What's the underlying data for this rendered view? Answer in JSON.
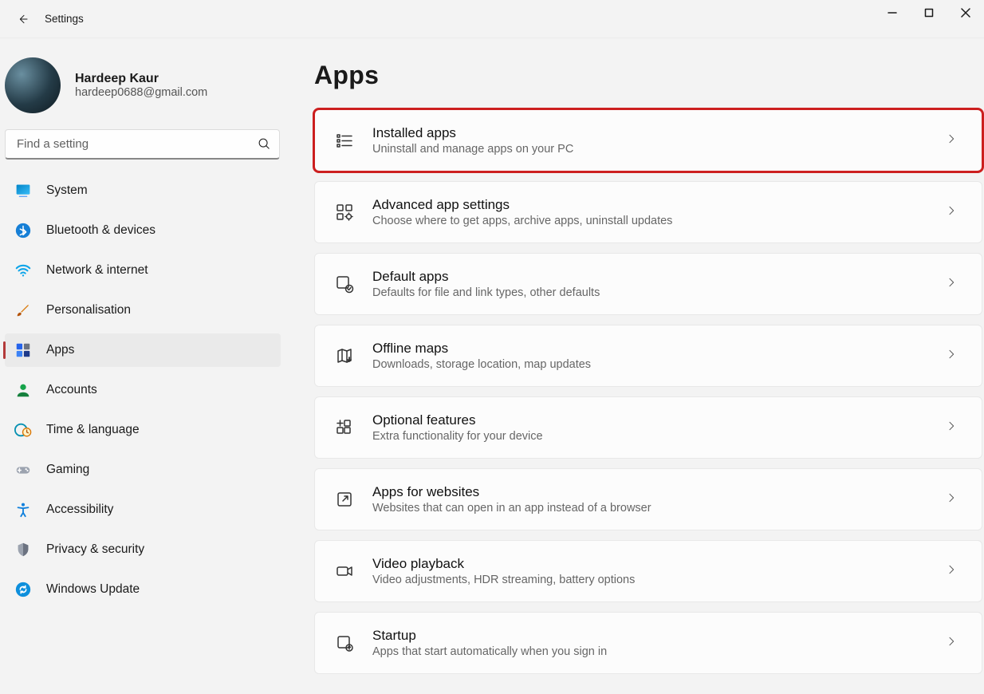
{
  "window": {
    "title": "Settings"
  },
  "profile": {
    "name": "Hardeep Kaur",
    "email": "hardeep0688@gmail.com"
  },
  "search": {
    "placeholder": "Find a setting"
  },
  "nav": {
    "items": [
      {
        "id": "system",
        "label": "System"
      },
      {
        "id": "bluetooth",
        "label": "Bluetooth & devices"
      },
      {
        "id": "network",
        "label": "Network & internet"
      },
      {
        "id": "personalisation",
        "label": "Personalisation"
      },
      {
        "id": "apps",
        "label": "Apps",
        "selected": true
      },
      {
        "id": "accounts",
        "label": "Accounts"
      },
      {
        "id": "time",
        "label": "Time & language"
      },
      {
        "id": "gaming",
        "label": "Gaming"
      },
      {
        "id": "accessibility",
        "label": "Accessibility"
      },
      {
        "id": "privacy",
        "label": "Privacy & security"
      },
      {
        "id": "update",
        "label": "Windows Update"
      }
    ]
  },
  "page": {
    "title": "Apps",
    "cards": [
      {
        "id": "installed",
        "title": "Installed apps",
        "subtitle": "Uninstall and manage apps on your PC",
        "highlighted": true
      },
      {
        "id": "advanced",
        "title": "Advanced app settings",
        "subtitle": "Choose where to get apps, archive apps, uninstall updates"
      },
      {
        "id": "default",
        "title": "Default apps",
        "subtitle": "Defaults for file and link types, other defaults"
      },
      {
        "id": "offline",
        "title": "Offline maps",
        "subtitle": "Downloads, storage location, map updates"
      },
      {
        "id": "optional",
        "title": "Optional features",
        "subtitle": "Extra functionality for your device"
      },
      {
        "id": "websites",
        "title": "Apps for websites",
        "subtitle": "Websites that can open in an app instead of a browser"
      },
      {
        "id": "video",
        "title": "Video playback",
        "subtitle": "Video adjustments, HDR streaming, battery options"
      },
      {
        "id": "startup",
        "title": "Startup",
        "subtitle": "Apps that start automatically when you sign in"
      }
    ]
  },
  "icons": {
    "nav": {
      "system": "monitor-icon",
      "bluetooth": "bluetooth-icon",
      "network": "wifi-icon",
      "personalisation": "brush-icon",
      "apps": "apps-grid-icon",
      "accounts": "person-icon",
      "time": "clock-globe-icon",
      "gaming": "gamepad-icon",
      "accessibility": "accessibility-icon",
      "privacy": "shield-icon",
      "update": "refresh-icon"
    },
    "cards": {
      "installed": "list-icon",
      "advanced": "app-cog-icon",
      "default": "app-check-icon",
      "offline": "map-download-icon",
      "optional": "grid-plus-icon",
      "websites": "open-external-icon",
      "video": "video-icon",
      "startup": "app-arrow-icon"
    }
  }
}
